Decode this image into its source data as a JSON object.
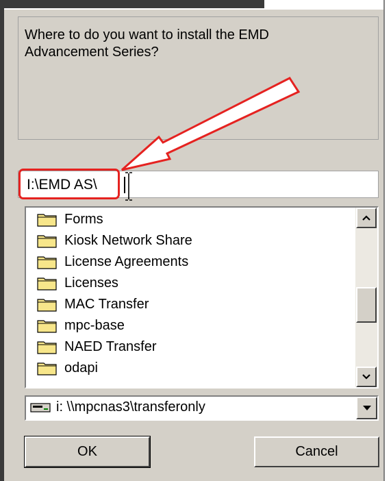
{
  "prompt": {
    "line1": "Where to do you want to install the EMD",
    "line2": "Advancement Series?"
  },
  "path_input": {
    "value": "I:\\EMD AS\\"
  },
  "folders": [
    {
      "label": "Forms"
    },
    {
      "label": "Kiosk Network Share"
    },
    {
      "label": "License Agreements"
    },
    {
      "label": "Licenses"
    },
    {
      "label": "MAC Transfer"
    },
    {
      "label": "mpc-base"
    },
    {
      "label": "NAED Transfer"
    },
    {
      "label": "odapi"
    }
  ],
  "drive_select": {
    "value": "i:  \\\\mpcnas3\\transferonly",
    "icon": "network-drive-icon"
  },
  "buttons": {
    "ok": "OK",
    "cancel": "Cancel"
  },
  "colors": {
    "annotation_red": "#e52220",
    "dialog_face": "#d4d0c8"
  }
}
